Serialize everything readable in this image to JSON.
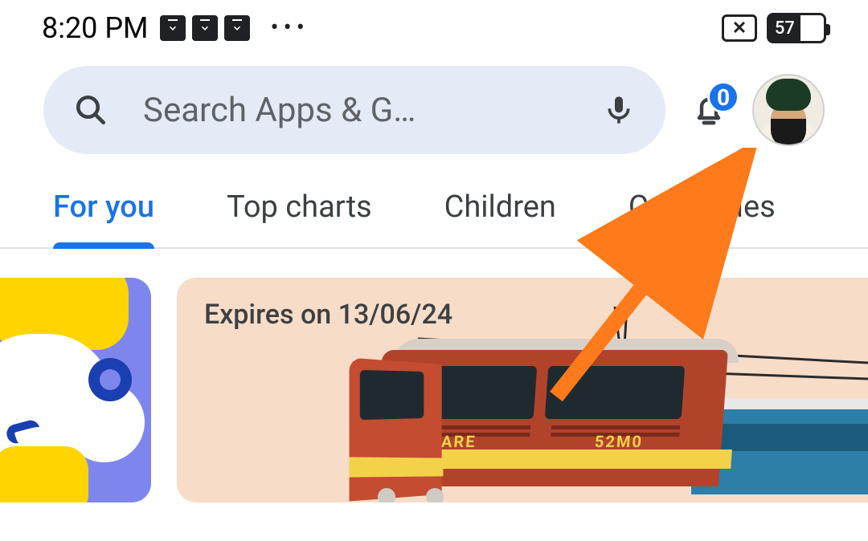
{
  "status": {
    "time": "8:20 PM",
    "download_icons_count": 3,
    "overflow": "•••",
    "battery_percent": "57"
  },
  "search": {
    "placeholder": "Search Apps & G…"
  },
  "notifications": {
    "badge_count": "0"
  },
  "tabs": [
    {
      "label": "For you",
      "active": true
    },
    {
      "label": "Top charts",
      "active": false
    },
    {
      "label": "Children",
      "active": false
    },
    {
      "label": "Categories",
      "active": false
    }
  ],
  "promo": {
    "expires_label": "Expires on 13/06/24",
    "loco_text_left": "WARE",
    "loco_text_right": "52M0"
  },
  "colors": {
    "accent": "#1a73e8",
    "search_bg": "#e4eaf6",
    "arrow": "#ff7a1a"
  }
}
